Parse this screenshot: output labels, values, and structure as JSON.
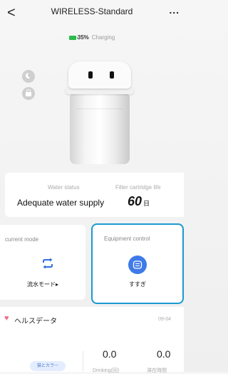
{
  "header": {
    "title": "WIRELESS-Standard",
    "back_glyph": "<",
    "more_glyph": "..."
  },
  "battery": {
    "percent": "35%",
    "status": "Charging",
    "icon": "battery-icon",
    "color": "#2dbb4c"
  },
  "side_buttons": [
    {
      "icon": "moon-icon"
    },
    {
      "icon": "lock-icon"
    }
  ],
  "status": {
    "water_status_label": "Water status",
    "water_status_value": "Adequate water supply",
    "filter_label": "Filter cartridge life",
    "filter_value": "60",
    "filter_unit": "日"
  },
  "mode": {
    "label": "current mode",
    "value": "流水モード▸",
    "icon": "repeat-arrows-icon",
    "accent": "#2f6fe0"
  },
  "equipment": {
    "label": "Equipment control",
    "value": "すすぎ",
    "icon": "rinse-icon",
    "accent": "#3f7ae8",
    "highlight": "#1b9ad2"
  },
  "health": {
    "title": "ヘルスデータ",
    "date": "09-04",
    "pill": "猫とカラー",
    "drinking_value": "0.0",
    "drinking_label": "Drinking(回)",
    "stay_value": "0.0",
    "stay_label": "滞在時間"
  }
}
